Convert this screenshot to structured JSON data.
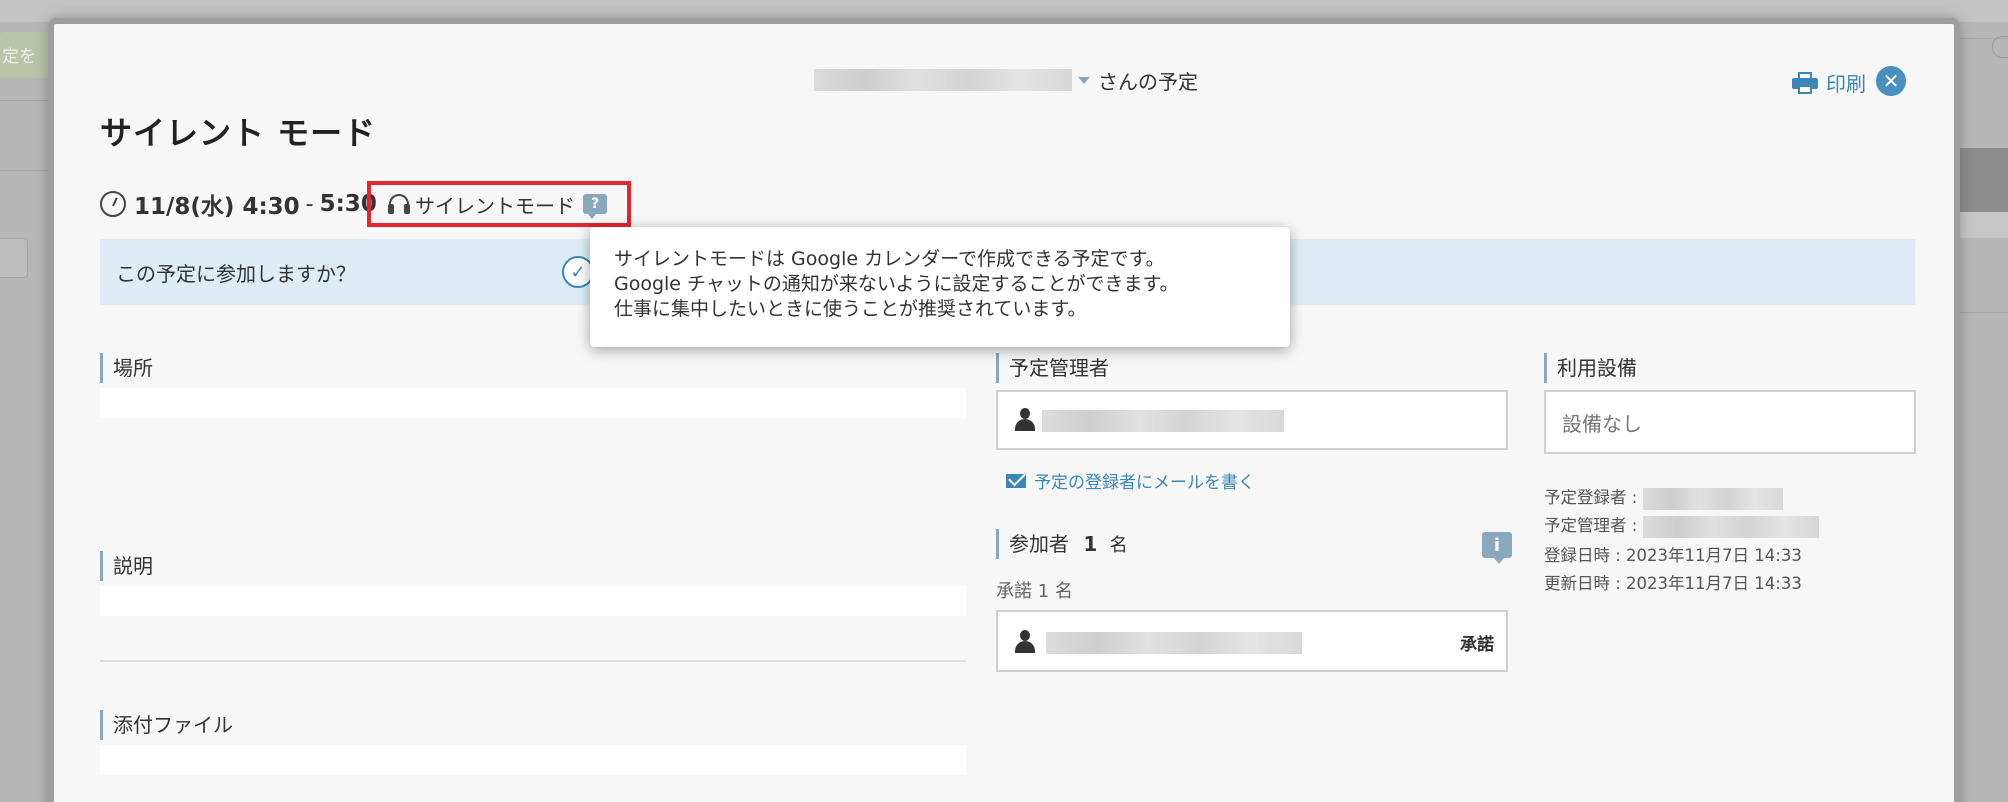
{
  "background": {
    "button_text": "定を"
  },
  "header": {
    "owner_suffix": "さんの予定",
    "print_label": "印刷",
    "close_label": "✕"
  },
  "event": {
    "title": "サイレント モード",
    "start": "11/8(水) 4:30",
    "separator": "-",
    "end": "5:30",
    "mode_label": "サイレントモード",
    "help_label": "?"
  },
  "join": {
    "question": "この予定に参加しますか？"
  },
  "tooltip": {
    "lines": [
      "サイレントモードは Google カレンダーで作成できる予定です。",
      "Google チャットの通知が来ないように設定することができます。",
      "仕事に集中したいときに使うことが推奨されています。"
    ]
  },
  "sections": {
    "location": "場所",
    "description": "説明",
    "attachments": "添付ファイル",
    "organizer": "予定管理者",
    "facilities": "利用設備",
    "participants_label": "参加者",
    "participants_count": "1",
    "participants_unit": "名",
    "accepted_summary": "承諾 1 名"
  },
  "organizer": {
    "mail_link": "予定の登録者にメールを書く"
  },
  "facilities": {
    "value": "設備なし"
  },
  "participant": {
    "status": "承諾"
  },
  "meta": {
    "registrant_label": "予定登録者 :",
    "manager_label": "予定管理者 :",
    "registered_at": "登録日時 : 2023年11月7日 14:33",
    "updated_at": "更新日時 : 2023年11月7日 14:33"
  },
  "colors": {
    "accent": "#3a87b8",
    "highlight_border": "#e3262e",
    "join_bar_bg": "#deedf5"
  }
}
